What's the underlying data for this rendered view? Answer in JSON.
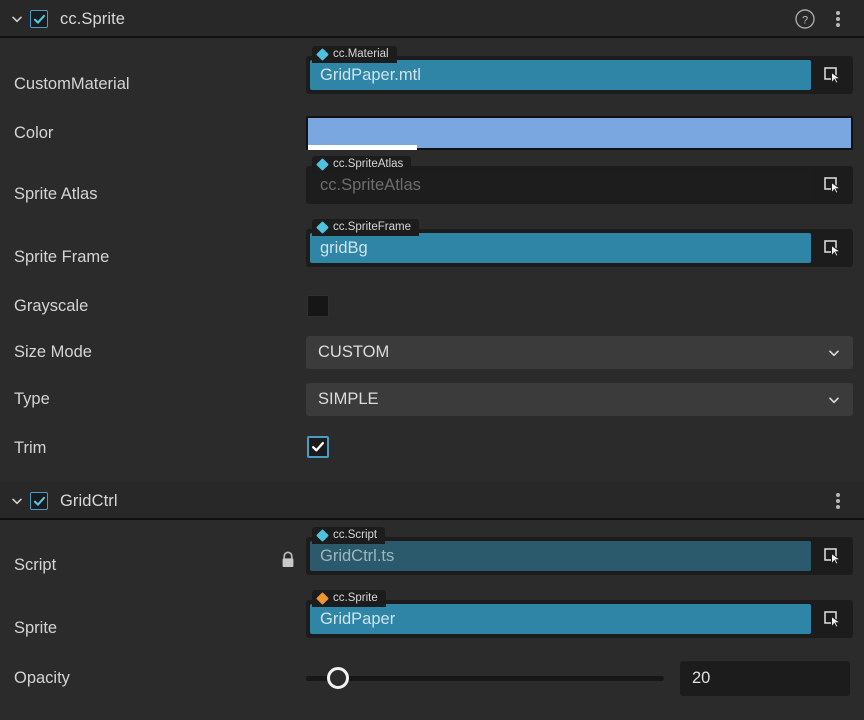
{
  "colors": {
    "panel_bg": "#2b2b2b",
    "header_bg": "#282828",
    "accent_teal": "#2e85a6",
    "accent_check": "#4a9cc4",
    "asset_diamond": "#4ec3e0",
    "component_diamond": "#f0962e",
    "color_swatch": "#7aa7e0",
    "select_bg": "#3b3b3b",
    "readonly_teal": "#2a5a6b"
  },
  "components": [
    {
      "name": "cc.Sprite",
      "enabled": true,
      "expanded": true,
      "has_help": true,
      "has_menu": true,
      "help_icon": "help-circle-icon",
      "menu_icon": "kebab-menu-icon",
      "chevron_icon": "chevron-down-icon"
    },
    {
      "name": "GridCtrl",
      "enabled": true,
      "expanded": true,
      "has_help": false,
      "has_menu": true,
      "menu_icon": "kebab-menu-icon",
      "chevron_icon": "chevron-down-icon"
    }
  ],
  "sprite": {
    "custom_material": {
      "label": "CustomMaterial",
      "type_tag": "cc.Material",
      "tag_icon": "asset-diamond-icon",
      "tag_color": "#4ec3e0",
      "value": "GridPaper.mtl",
      "empty": false,
      "pick_icon": "locate-asset-icon"
    },
    "color": {
      "label": "Color",
      "swatch": "#7aa7e0",
      "alpha_percent": 20
    },
    "sprite_atlas": {
      "label": "Sprite Atlas",
      "type_tag": "cc.SpriteAtlas",
      "tag_icon": "asset-diamond-icon",
      "tag_color": "#4ec3e0",
      "value": "",
      "placeholder": "cc.SpriteAtlas",
      "empty": true,
      "pick_icon": "locate-asset-icon"
    },
    "sprite_frame": {
      "label": "Sprite Frame",
      "type_tag": "cc.SpriteFrame",
      "tag_icon": "asset-diamond-icon",
      "tag_color": "#4ec3e0",
      "value": "gridBg",
      "empty": false,
      "pick_icon": "locate-asset-icon"
    },
    "grayscale": {
      "label": "Grayscale",
      "checked": false
    },
    "size_mode": {
      "label": "Size Mode",
      "value": "CUSTOM",
      "chevron_icon": "chevron-down-icon"
    },
    "type": {
      "label": "Type",
      "value": "SIMPLE",
      "chevron_icon": "chevron-down-icon"
    },
    "trim": {
      "label": "Trim",
      "checked": true
    }
  },
  "gridctrl": {
    "script": {
      "label": "Script",
      "type_tag": "cc.Script",
      "tag_icon": "asset-diamond-icon",
      "tag_color": "#4ec3e0",
      "value": "GridCtrl.ts",
      "readonly": true,
      "lock_icon": "lock-icon",
      "pick_icon": "locate-asset-icon"
    },
    "sprite": {
      "label": "Sprite",
      "type_tag": "cc.Sprite",
      "tag_icon": "component-diamond-icon",
      "tag_color": "#f0962e",
      "value": "GridPaper",
      "readonly": false,
      "pick_icon": "locate-asset-icon"
    },
    "opacity": {
      "label": "Opacity",
      "value": "20",
      "slider_percent": 9,
      "min": 0,
      "max": 255
    }
  }
}
